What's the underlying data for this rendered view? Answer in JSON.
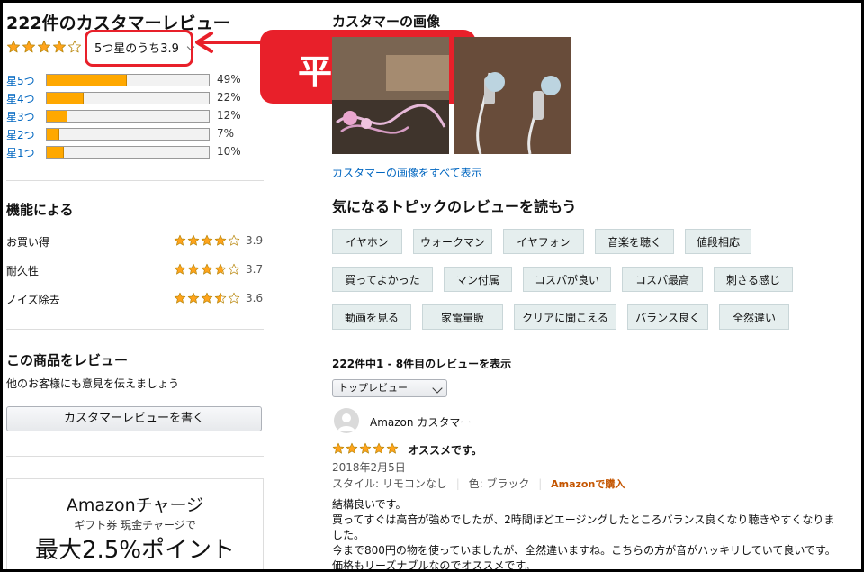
{
  "left": {
    "title": "222件のカスタマーレビュー",
    "rating_fill": [
      1,
      1,
      1,
      1,
      0
    ],
    "avg_label": "5つ星のうち3.9",
    "distribution": [
      {
        "label": "星5つ",
        "percent_text": "49%",
        "percent": 49
      },
      {
        "label": "星4つ",
        "percent_text": "22%",
        "percent": 22
      },
      {
        "label": "星3つ",
        "percent_text": "12%",
        "percent": 12
      },
      {
        "label": "星2つ",
        "percent_text": "7%",
        "percent": 7
      },
      {
        "label": "星1つ",
        "percent_text": "10%",
        "percent": 10
      }
    ],
    "features_title": "機能による",
    "features": [
      {
        "name": "お買い得",
        "value": "3.9",
        "rating": 3.9
      },
      {
        "name": "耐久性",
        "value": "3.7",
        "rating": 3.7
      },
      {
        "name": "ノイズ除去",
        "value": "3.6",
        "rating": 3.6
      }
    ],
    "review_title": "この商品をレビュー",
    "review_sub": "他のお客様にも意見を伝えましょう",
    "write_button": "カスタマーレビューを書く",
    "ad_line1": "Amazonチャージ",
    "ad_line2": "ギフト券 現金チャージで",
    "ad_line3": "最大2.5%ポイント"
  },
  "callout": {
    "text": "平均評価"
  },
  "right": {
    "images_title": "カスタマーの画像",
    "see_all_images": "カスタマーの画像をすべて表示",
    "topics_title": "気になるトピックのレビューを読もう",
    "topics": [
      [
        "イヤホン",
        "ウォークマン",
        "イヤフォン",
        "音楽を聴く",
        "値段相応"
      ],
      [
        "買ってよかった",
        "マン付属",
        "コスパが良い",
        "コスパ最高",
        "刺さる感じ"
      ],
      [
        "動画を見る",
        "家電量販",
        "クリアに聞こえる",
        "バランス良く",
        "全然違い"
      ]
    ],
    "count_text": "222件中1 - 8件目のレビューを表示",
    "sort_selected": "トップレビュー",
    "review": {
      "author": "Amazon カスタマー",
      "rating": 5,
      "title": "オススメです。",
      "date": "2018年2月5日",
      "style": "スタイル: リモコンなし",
      "color": "色: ブラック",
      "badge": "Amazonで購入",
      "body": [
        "結構良いです。",
        "買ってすぐは高音が強めでしたが、2時間ほどエージングしたところバランス良くなり聴きやすくなりま",
        "した。",
        "今まで800円の物を使っていましたが、全然違いますね。こちらの方が音がハッキリしていて良いです。",
        "価格もリーズナブルなのでオススメです。"
      ]
    }
  },
  "colors": {
    "accent_red": "#e8202a",
    "star": "#ffa41c",
    "link": "#0066c0",
    "bar": "#ffa800"
  }
}
